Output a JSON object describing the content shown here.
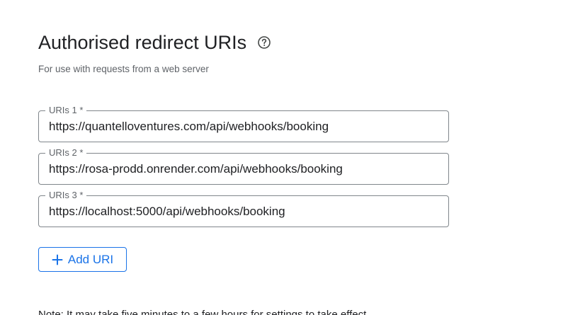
{
  "section": {
    "title": "Authorised redirect URIs",
    "help_icon": "help-circle-icon",
    "subtitle": "For use with requests from a web server"
  },
  "uris": [
    {
      "label": "URIs 1 *",
      "value": "https://quantelloventures.com/api/webhooks/booking"
    },
    {
      "label": "URIs 2 *",
      "value": "https://rosa-prodd.onrender.com/api/webhooks/booking"
    },
    {
      "label": "URIs 3 *",
      "value": "https://localhost:5000/api/webhooks/booking"
    }
  ],
  "add_button": {
    "icon": "plus-icon",
    "label": "Add URI"
  },
  "note": "Note: It may take five minutes to a few hours for settings to take effect",
  "colors": {
    "accent": "#1a73e8",
    "border": "#80868b",
    "text": "#202124",
    "muted": "#5f6368"
  }
}
